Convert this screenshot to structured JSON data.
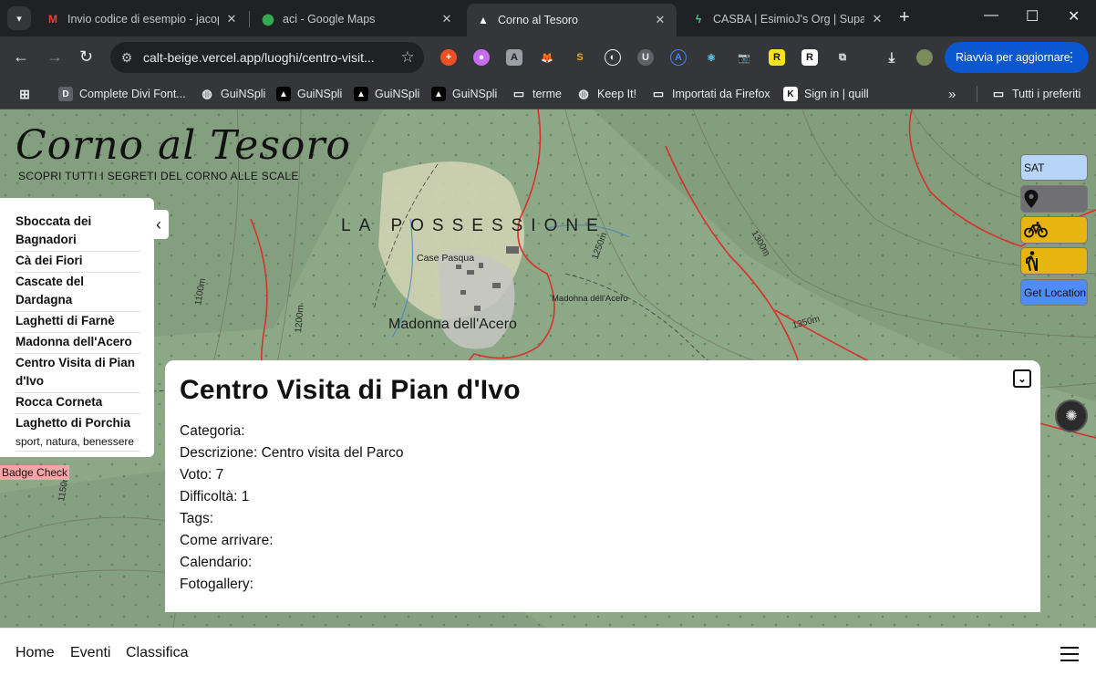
{
  "tabs": [
    {
      "title": "Invio codice di esempio - jacop",
      "icon": "gmail-icon",
      "color": "#ea4335"
    },
    {
      "title": "aci - Google Maps",
      "icon": "maps-icon",
      "color": "#34a853"
    },
    {
      "title": "Corno al Tesoro",
      "icon": "vercel-icon",
      "color": "#ffffff"
    },
    {
      "title": "CASBA | EsimioJ's Org | Supaba",
      "icon": "supabase-icon",
      "color": "#3ecf8e"
    }
  ],
  "omnibox": {
    "url": "calt-beige.vercel.app/luoghi/centro-visit..."
  },
  "update_button": "Riavvia per aggiornare",
  "bookmarks": [
    {
      "label": "Complete Divi Font...",
      "icon": "divi-icon"
    },
    {
      "label": "GuiNSpli",
      "icon": "globe-icon"
    },
    {
      "label": "GuiNSpli",
      "icon": "vercel-icon"
    },
    {
      "label": "GuiNSpli",
      "icon": "vercel-icon"
    },
    {
      "label": "GuiNSpli",
      "icon": "vercel-icon"
    },
    {
      "label": "terme",
      "icon": "folder-icon"
    },
    {
      "label": "Keep It!",
      "icon": "globe-icon"
    },
    {
      "label": "Importati da Firefox",
      "icon": "folder-icon"
    },
    {
      "label": "Sign in | quill",
      "icon": "k-icon"
    }
  ],
  "bookmarks_all": "Tutti i preferiti",
  "map_labels": {
    "region": "LA POSSESSIONE",
    "village": "Madonna dell'Acero",
    "place1": "Case Pasqua",
    "place2": "Madonna dell'Acero",
    "contour1": "1100m",
    "contour2": "1200m",
    "contour3": "1300m",
    "contour4": "1350m",
    "contour5": "1250m",
    "contour6": "1150m"
  },
  "site": {
    "title": "Corno al Tesoro",
    "subtitle": "SCOPRI TUTTI I SEGRETI DEL CORNO ALLE SCALE"
  },
  "sidebar": {
    "items": [
      "Sboccata dei Bagnadori",
      "Cà dei Fiori",
      "Cascate del Dardagna",
      "Laghetti di Farnè",
      "Madonna dell'Acero",
      "Centro Visita di Pian d'Ivo",
      "Rocca Corneta",
      "Laghetto di Porchia"
    ],
    "last_item_sub": "sport, natura, benessere"
  },
  "badge_check": "Badge Check",
  "controls": {
    "sat": "SAT",
    "location": "Get Location"
  },
  "card": {
    "title": "Centro Visita di Pian d'Ivo",
    "fields": [
      "Categoria:",
      "Descrizione: Centro visita del Parco",
      "Voto: 7",
      "Difficoltà: 1",
      "Tags:",
      "Come arrivare:",
      "Calendario:",
      "Fotogallery:"
    ]
  },
  "bottom_nav": [
    "Home",
    "Eventi",
    "Classifica"
  ]
}
